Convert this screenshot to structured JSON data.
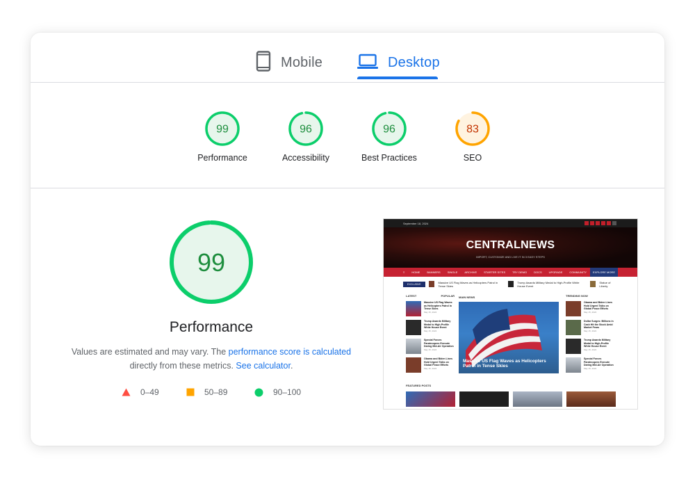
{
  "tabs": [
    {
      "label": "Mobile",
      "icon": "smartphone-icon",
      "active": false
    },
    {
      "label": "Desktop",
      "icon": "laptop-icon",
      "active": true
    }
  ],
  "categories": [
    {
      "score": "99",
      "label": "Performance",
      "color": "#0cce6b",
      "fill": 0.99
    },
    {
      "score": "96",
      "label": "Accessibility",
      "color": "#0cce6b",
      "fill": 0.96
    },
    {
      "score": "96",
      "label": "Best Practices",
      "color": "#0cce6b",
      "fill": 0.96
    },
    {
      "score": "83",
      "label": "SEO",
      "color": "#ffa400",
      "fill": 0.83
    }
  ],
  "performance": {
    "score": "99",
    "fill": 0.99,
    "title": "Performance",
    "desc_prefix": "Values are estimated and may vary. The ",
    "link_score": "performance score is calculated",
    "desc_middle": "directly from these metrics. ",
    "link_calculator": "See calculator",
    "desc_suffix": "."
  },
  "legend": [
    {
      "range": "0–49",
      "shape": "triangle",
      "color": "#ff4e42"
    },
    {
      "range": "50–89",
      "shape": "square",
      "color": "#ffa400"
    },
    {
      "range": "90–100",
      "shape": "circle",
      "color": "#0cce6b"
    }
  ],
  "screenshot": {
    "date": "September 18, 2024",
    "logo": "CENTRALNEWS",
    "tagline": "IMPORT, CUSTOMIZE AND LIVE IT IN 3 EASY STEPS",
    "nav": [
      "HOME",
      "BANNERS",
      "SINGLE",
      "ARCHIVE",
      "STARTER SITES",
      "TRY DEMO",
      "DOCS",
      "UPGRADE",
      "COMMUNITY"
    ],
    "explore": "EXPLORE MORE",
    "ticker_label": "EXCLUSIVE",
    "ticker": [
      "Massive US Flag Waves as Helicopters Patrol in Tense Skies",
      "Trump Awards Military Medal to High-Profile White House Event",
      "Statue of Liberty"
    ],
    "left_tabs": [
      "LATEST",
      "POPULAR"
    ],
    "main_news_heading": "MAIN NEWS",
    "trending_heading": "TRENDING NOW",
    "main_caption": "Massive US Flag Waves as Helicopters Patrol in Tense Skies",
    "latest": [
      "Massive US Flag Waves as Helicopters Patrol in Tense Skies",
      "Trump Awards Military Medal to High-Profile White House Event",
      "Special Forces Paratroopers Execute Daring Mid-Air Operation",
      "Obama and Biden Lines Hold Urgent Talks on Global Peace Efforts"
    ],
    "trending": [
      "Obama and Biden Lines Hold Urgent Talks on Global Peace Efforts",
      "Dollar Surges: Billions in Cash Hit the Stock Amid Market Fears",
      "Trump Awards Military Medal to High-Profile White House Event",
      "Special Forces Paratroopers Execute Daring Mid-Air Operation"
    ],
    "item_date": "May 15, 2024",
    "featured_heading": "FEATURED POSTS"
  }
}
